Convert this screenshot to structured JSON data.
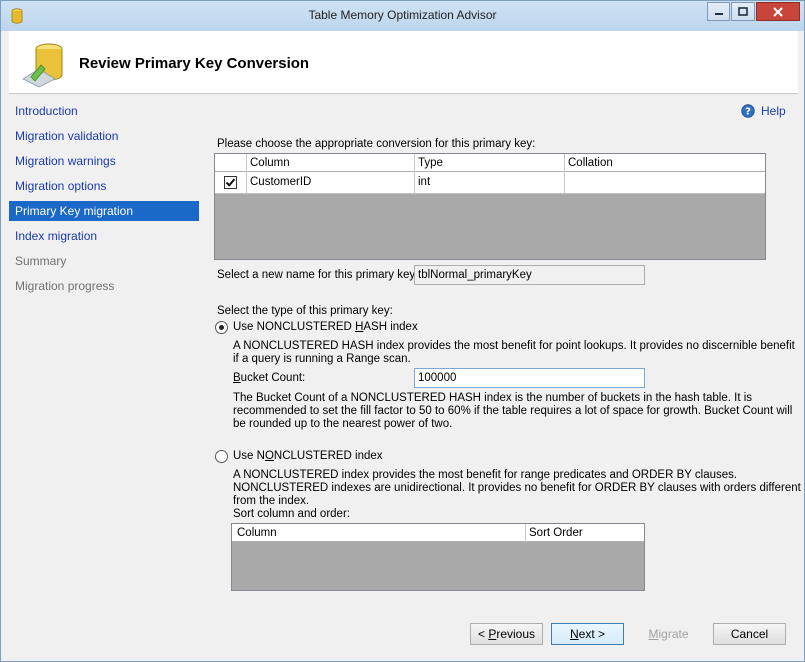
{
  "window": {
    "title": "Table Memory Optimization Advisor"
  },
  "header": {
    "title": "Review Primary Key Conversion"
  },
  "nav": {
    "items": [
      {
        "label": "Introduction",
        "state": "link"
      },
      {
        "label": "Migration validation",
        "state": "link"
      },
      {
        "label": "Migration warnings",
        "state": "link"
      },
      {
        "label": "Migration options",
        "state": "link"
      },
      {
        "label": "Primary Key migration",
        "state": "selected"
      },
      {
        "label": "Index migration",
        "state": "link"
      },
      {
        "label": "Summary",
        "state": "disabled"
      },
      {
        "label": "Migration progress",
        "state": "disabled"
      }
    ]
  },
  "help": {
    "label": "Help",
    "icon": "help-icon"
  },
  "main": {
    "prompt": "Please choose the appropriate conversion for this primary key:",
    "pk_grid": {
      "columns": [
        "Column",
        "Type",
        "Collation"
      ],
      "rows": [
        {
          "checked": true,
          "column": "CustomerID",
          "type": "int",
          "collation": ""
        }
      ]
    },
    "new_name_label": "Select a new name for this primary key:",
    "new_name_value": "tblNormal_primaryKey",
    "type_label": "Select the type of this primary key:",
    "hash_option": {
      "label_pre": "Use NONCLUSTERED ",
      "label_u": "H",
      "label_post": "ASH index",
      "selected": true,
      "desc_line1": "A NONCLUSTERED HASH index provides the most benefit for point lookups. It provides no discernible benefit",
      "desc_line2": "if a query is running a Range scan.",
      "bucket_label_u": "B",
      "bucket_label_rest": "ucket Count:",
      "bucket_value": "100000",
      "bucket_desc_line1": "The Bucket Count of a NONCLUSTERED HASH index is the number of buckets in the hash table. It is",
      "bucket_desc_line2": "recommended to set the fill factor to 50 to 60% if the table requires a lot of space for growth. Bucket Count will",
      "bucket_desc_line3": "be rounded up to the nearest power of two."
    },
    "nc_option": {
      "label_pre": "Use N",
      "label_u": "O",
      "label_post": "NCLUSTERED index",
      "selected": false,
      "desc_line1": "A NONCLUSTERED index provides the most benefit for range predicates and ORDER BY clauses.",
      "desc_line2": "NONCLUSTERED indexes are unidirectional. It provides no benefit for ORDER BY clauses with orders different",
      "desc_line3": "from the index.",
      "sort_label": "Sort column and order:",
      "sort_grid": {
        "columns": [
          "Column",
          "Sort Order"
        ]
      }
    }
  },
  "buttons": {
    "previous": {
      "pre": "< ",
      "u": "P",
      "post": "revious"
    },
    "next": {
      "u": "N",
      "post": "ext >"
    },
    "migrate": {
      "u": "M",
      "post": "igrate"
    },
    "cancel": "Cancel"
  }
}
